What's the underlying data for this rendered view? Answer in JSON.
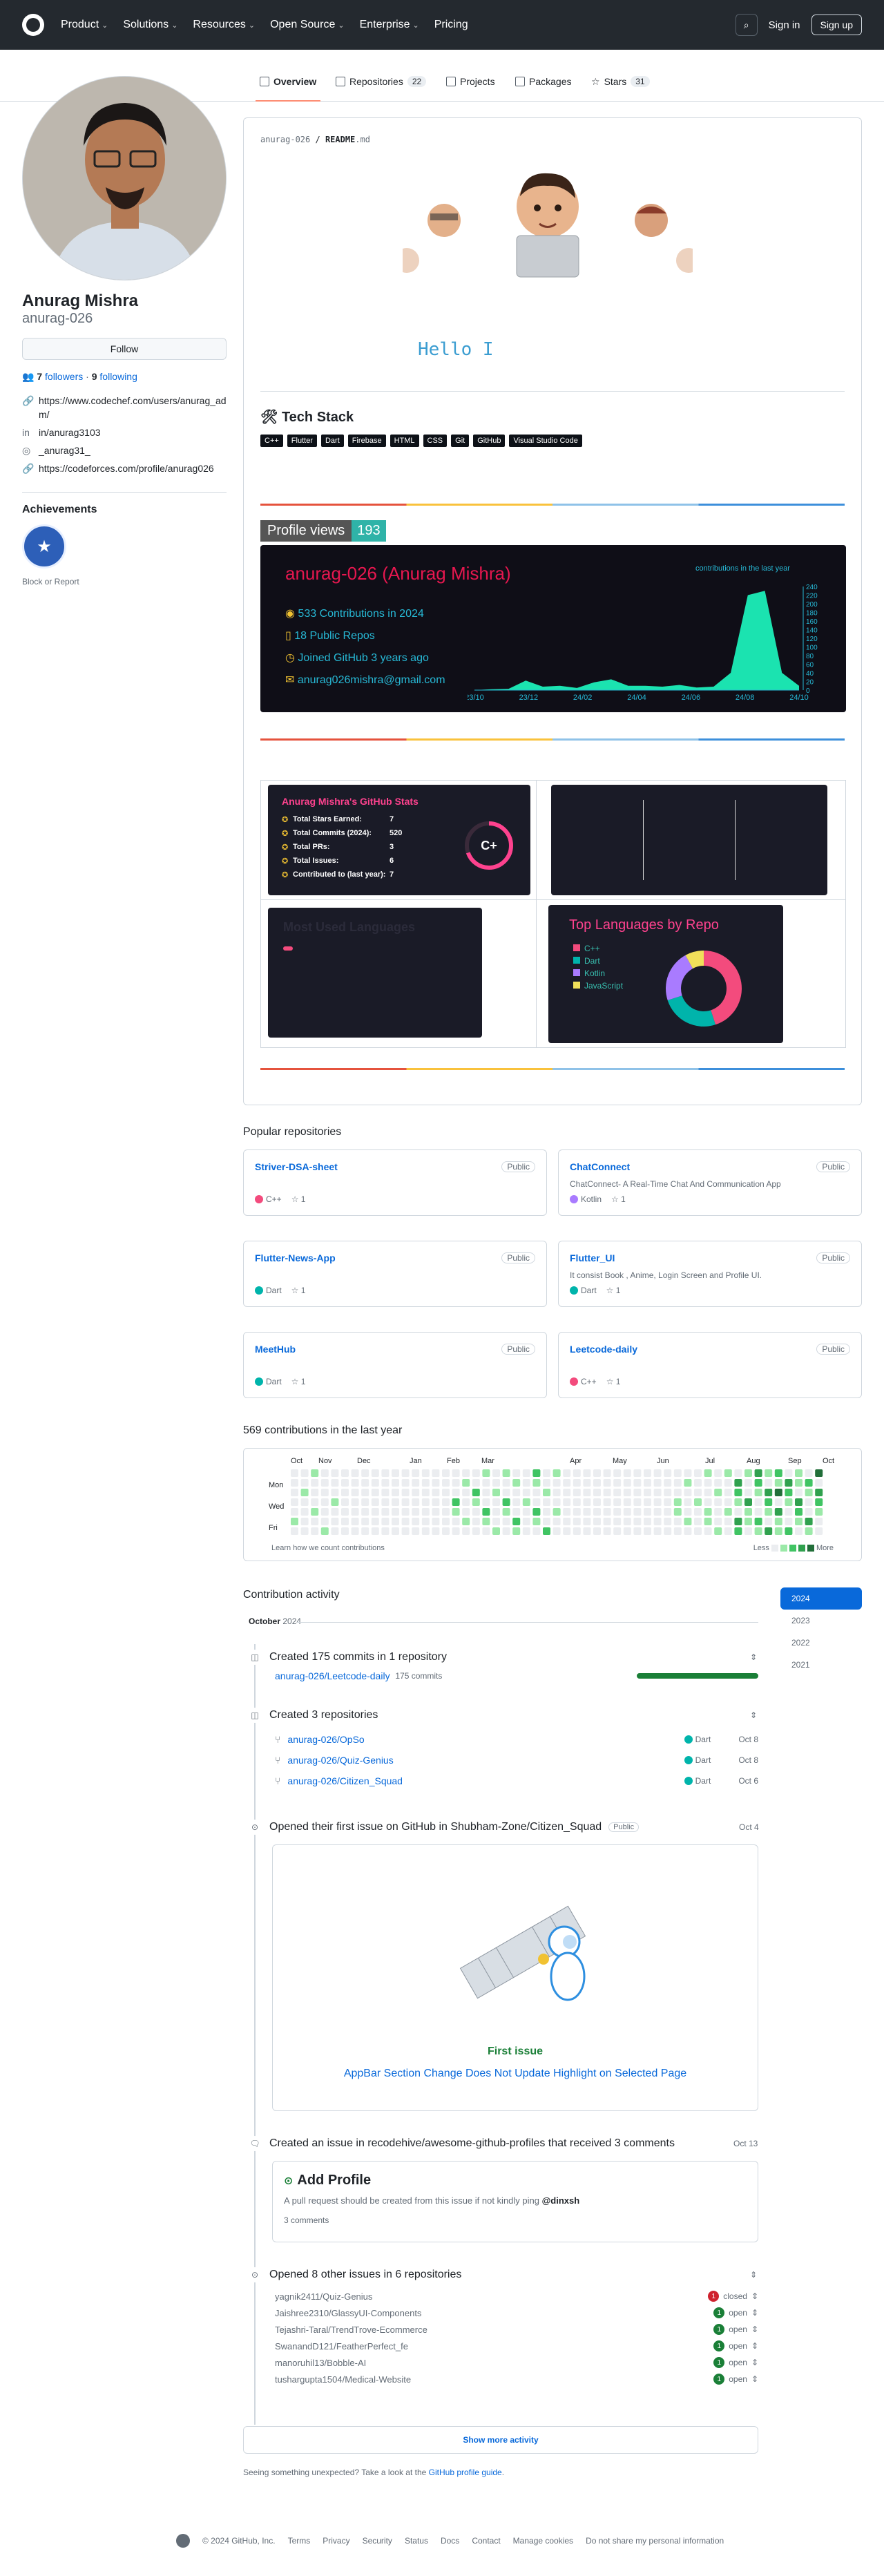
{
  "header": {
    "nav": [
      "Product",
      "Solutions",
      "Resources",
      "Open Source",
      "Enterprise",
      "Pricing"
    ],
    "signin": "Sign in",
    "signup": "Sign up"
  },
  "tabs": [
    {
      "label": "Overview"
    },
    {
      "label": "Repositories",
      "count": "22"
    },
    {
      "label": "Projects"
    },
    {
      "label": "Packages"
    },
    {
      "label": "Stars",
      "count": "31"
    }
  ],
  "profile": {
    "name": "Anurag Mishra",
    "login": "anurag-026",
    "follow": "Follow",
    "followers": "7",
    "followers_label": "followers",
    "following": "9",
    "following_label": "following",
    "links": [
      "https://www.codechef.com/users/anurag_adm/",
      "in/anurag3103",
      "_anurag31_",
      "https://codeforces.com/profile/anurag026"
    ],
    "achievements": "Achievements",
    "block": "Block or Report"
  },
  "readme": {
    "path_user": "anurag-026",
    "path_file": "README",
    "path_ext": ".md",
    "hello": "Hello I",
    "tech_title": "Tech Stack",
    "tech": [
      "C++",
      "Flutter",
      "Dart",
      "Firebase",
      "HTML",
      "CSS",
      "Git",
      "GitHub",
      "Visual Studio Code"
    ],
    "views_label": "Profile views",
    "views": "193",
    "graph": {
      "title": "anurag-026 (Anurag Mishra)",
      "contrib": "533 Contributions in 2024",
      "repos": "18 Public Repos",
      "joined": "Joined GitHub 3 years ago",
      "email": "anurag026mishra@gmail.com",
      "caption": "contributions in the last year"
    },
    "stats": {
      "title": "Anurag Mishra's GitHub Stats",
      "rows": [
        [
          "Total Stars Earned:",
          "7"
        ],
        [
          "Total Commits (2024):",
          "520"
        ],
        [
          "Total PRs:",
          "3"
        ],
        [
          "Total Issues:",
          "6"
        ],
        [
          "Contributed to (last year):",
          "7"
        ]
      ],
      "grade": "C+"
    },
    "most_used": "Most Used Languages",
    "top_lang": "Top Languages by Repo",
    "langs": [
      "C++",
      "Dart",
      "Kotlin",
      "JavaScript"
    ]
  },
  "chart_data": [
    {
      "type": "area",
      "title": "contributions in the last year",
      "x": [
        "23/10",
        "23/12",
        "24/02",
        "24/04",
        "24/06",
        "24/08",
        "24/10"
      ],
      "y_ticks": [
        "0",
        "20",
        "40",
        "60",
        "80",
        "100",
        "120",
        "140",
        "160",
        "180",
        "200",
        "220",
        "240"
      ],
      "values": [
        0,
        2,
        3,
        22,
        8,
        10,
        5,
        18,
        25,
        10,
        10,
        8,
        12,
        6,
        8,
        40,
        220,
        230,
        40,
        10
      ]
    },
    {
      "type": "pie",
      "title": "Top Languages by Repo",
      "categories": [
        "C++",
        "Dart",
        "Kotlin",
        "JavaScript"
      ],
      "values": [
        45,
        25,
        22,
        8
      ]
    }
  ],
  "popular": {
    "title": "Popular repositories",
    "repos": [
      {
        "name": "Striver-DSA-sheet",
        "vis": "Public",
        "desc": "",
        "lang": "C++",
        "color": "#f34b7d",
        "stars": "1"
      },
      {
        "name": "ChatConnect",
        "vis": "Public",
        "desc": "ChatConnect- A Real-Time Chat And Communication App",
        "lang": "Kotlin",
        "color": "#a97bff",
        "stars": "1"
      },
      {
        "name": "Flutter-News-App",
        "vis": "Public",
        "desc": "",
        "lang": "Dart",
        "color": "#00b4ab",
        "stars": "1"
      },
      {
        "name": "Flutter_UI",
        "vis": "Public",
        "desc": "It consist Book , Anime, Login Screen and Profile UI.",
        "lang": "Dart",
        "color": "#00b4ab",
        "stars": "1"
      },
      {
        "name": "MeetHub",
        "vis": "Public",
        "desc": "",
        "lang": "Dart",
        "color": "#00b4ab",
        "stars": "1"
      },
      {
        "name": "Leetcode-daily",
        "vis": "Public",
        "desc": "",
        "lang": "C++",
        "color": "#f34b7d",
        "stars": "1"
      }
    ]
  },
  "calendar": {
    "title": "569 contributions in the last year",
    "months": [
      "Oct",
      "Nov",
      "Dec",
      "Jan",
      "Feb",
      "Mar",
      "Apr",
      "May",
      "Jun",
      "Jul",
      "Aug",
      "Sep",
      "Oct"
    ],
    "days": [
      "Mon",
      "Wed",
      "Fri"
    ],
    "learn": "Learn how we count contributions",
    "less": "Less",
    "more": "More"
  },
  "activity": {
    "title": "Contribution activity",
    "years": [
      "2024",
      "2023",
      "2022",
      "2021"
    ],
    "month": "October",
    "month_year": "2024",
    "commits": "Created 175 commits in 1 repository",
    "commit_repo": "anurag-026/Leetcode-daily",
    "commit_count": "175 commits",
    "repos_title": "Created 3 repositories",
    "repos": [
      [
        "anurag-026/OpSo",
        "Dart",
        "Oct 8"
      ],
      [
        "anurag-026/Quiz-Genius",
        "Dart",
        "Oct 8"
      ],
      [
        "anurag-026/Citizen_Squad",
        "Dart",
        "Oct 6"
      ]
    ],
    "first_issue": "Opened their first issue on GitHub in Shubham-Zone/Citizen_Squad",
    "first_vis": "Public",
    "first_date": "Oct 4",
    "first_label": "First issue",
    "first_title": "AppBar Section Change Does Not Update Highlight on Selected Page",
    "issue": "Created an issue in recodehive/awesome-github-profiles that received 3 comments",
    "issue_date": "Oct 13",
    "issue_title": "Add Profile",
    "issue_body": "A pull request should be created from this issue if not kindly ping",
    "issue_ping": "@dinxsh",
    "issue_comments": "3 comments",
    "other": "Opened 8 other issues in 6 repositories",
    "other_rows": [
      [
        "yagnik2411/Quiz-Genius",
        "1",
        "closed"
      ],
      [
        "Jaishree2310/GlassyUI-Components",
        "1",
        "open"
      ],
      [
        "Tejashri-Taral/TrendTrove-Ecommerce",
        "1",
        "open"
      ],
      [
        "SwanandD121/FeatherPerfect_fe",
        "1",
        "open"
      ],
      [
        "manoruhil13/Bobble-AI",
        "1",
        "open"
      ],
      [
        "tushargupta1504/Medical-Website",
        "1",
        "open"
      ]
    ],
    "show_more": "Show more activity",
    "unexpected": "Seeing something unexpected? Take a look at the",
    "guide": "GitHub profile guide",
    "period": "."
  },
  "footer": [
    "© 2024 GitHub, Inc.",
    "Terms",
    "Privacy",
    "Security",
    "Status",
    "Docs",
    "Contact",
    "Manage cookies",
    "Do not share my personal information"
  ]
}
